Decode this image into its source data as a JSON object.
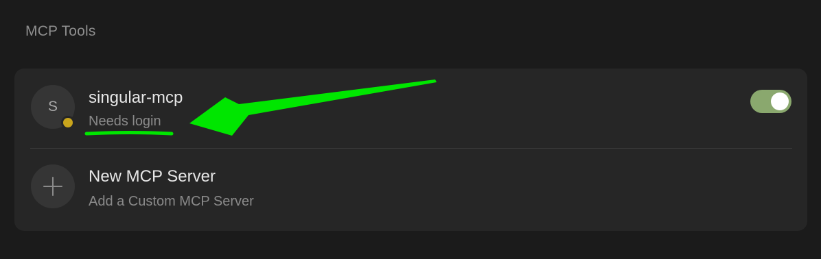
{
  "section": {
    "title": "MCP Tools"
  },
  "servers": [
    {
      "avatar_letter": "S",
      "name": "singular-mcp",
      "status_text": "Needs login",
      "status_color": "#c9a51c",
      "enabled": true
    }
  ],
  "new_server": {
    "title": "New MCP Server",
    "subtitle": "Add a Custom MCP Server",
    "icon": "plus-icon"
  },
  "annotation": {
    "color": "#00e600",
    "type": "arrow-and-underline",
    "target": "Needs login"
  },
  "colors": {
    "background": "#1b1b1b",
    "card": "#262626",
    "toggle_on": "#8aa86e"
  }
}
